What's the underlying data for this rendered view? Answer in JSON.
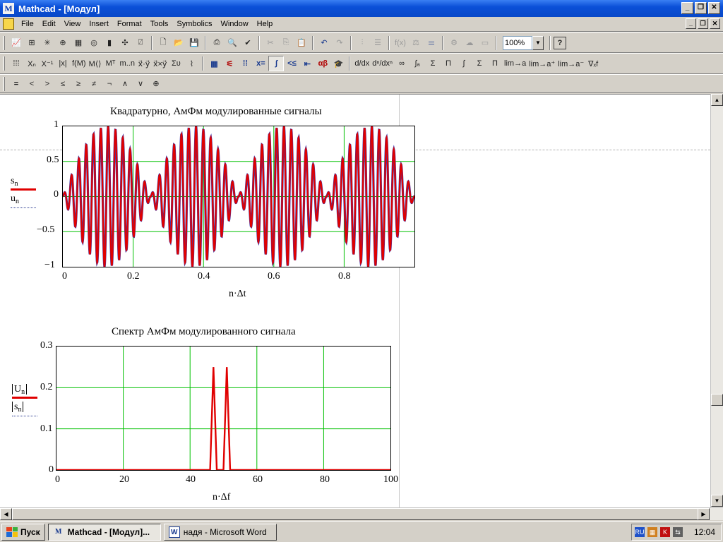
{
  "window": {
    "title": "Mathcad - [Модул]",
    "controls": [
      "minimize",
      "maximize",
      "close"
    ]
  },
  "menu": [
    "File",
    "Edit",
    "View",
    "Insert",
    "Format",
    "Tools",
    "Symbolics",
    "Window",
    "Help"
  ],
  "toolbar": {
    "zoom": "100%",
    "icons_row1": [
      "graph-toolbar-icon",
      "matrix-toolbar-icon",
      "evaluation-toolbar-icon",
      "calculus-toolbar-icon",
      "boolean-toolbar-icon",
      "programming-toolbar-icon",
      "greek-toolbar-icon",
      "symbolic-toolbar-icon",
      "modifier-toolbar-icon",
      "new-document-icon",
      "open-icon",
      "save-icon",
      "print-icon",
      "print-preview-icon",
      "spell-check-icon",
      "cut-icon",
      "copy-icon",
      "paste-icon",
      "undo-icon",
      "redo-icon",
      "align-across-icon",
      "align-down-icon",
      "insert-function-icon",
      "insert-unit-icon",
      "equals-icon",
      "calculate-icon",
      "component-icon",
      "insert-math-icon",
      "help-icon"
    ],
    "matrix_buttons": [
      "⁞⁞⁞",
      "Xₙ",
      "X⁻¹",
      "|x|",
      "f(M)",
      "M⟨⟩",
      "Mᵀ",
      "m..n",
      "x⃗·y⃗",
      "x⃗×y⃗",
      "Συ",
      "⌇"
    ],
    "palette_buttons": [
      "calculator",
      "graph",
      "matrix",
      "x=",
      "∫ d/dx",
      "<≤",
      "programming",
      "αβ",
      "symbolic"
    ],
    "calculus_buttons": [
      "d/dx",
      "dⁿ/dxⁿ",
      "∞",
      "∫ₐ",
      "Σ",
      "Π",
      "∫",
      "Σ",
      "Π",
      "lim→a",
      "lim→a⁺",
      "lim→a⁻",
      "∇ₓf"
    ],
    "boolean_buttons": [
      "=",
      "<",
      ">",
      "≤",
      "≥",
      "≠",
      "¬",
      "∧",
      "∨",
      "⊕"
    ]
  },
  "plot1": {
    "title": "Квадратурно, АмФм модулированные сигналы",
    "xlabel_main": "n·Δt",
    "legend": [
      {
        "sym": "s",
        "sub": "n"
      },
      {
        "sym": "u",
        "sub": "n"
      }
    ],
    "yticks": [
      "1",
      "0.5",
      "0",
      "−0.5",
      "−1"
    ],
    "xticks": [
      "0",
      "0.2",
      "0.4",
      "0.6",
      "0.8"
    ],
    "colors": {
      "s": "#e00000",
      "u": "#3a3ab0",
      "grid": "#00c000"
    }
  },
  "plot2": {
    "title": "Спектр АмФм модулированного сигнала",
    "xlabel_main": "n·Δf",
    "legend": [
      {
        "sym": "U",
        "sub": "n"
      },
      {
        "sym": "s",
        "sub": "n"
      }
    ],
    "yticks": [
      "0.3",
      "0.2",
      "0.1",
      "0"
    ],
    "xticks": [
      "0",
      "20",
      "40",
      "60",
      "80",
      "100"
    ]
  },
  "chart_data": [
    {
      "type": "line",
      "title": "Квадратурно, АмФм модулированные сигналы",
      "xlabel": "n·Δt",
      "ylabel": "s_n, u_n",
      "xlim": [
        0,
        1
      ],
      "ylim": [
        -1,
        1
      ],
      "grid": true,
      "legend_position": "left",
      "description_series": [
        {
          "name": "s_n",
          "style": "solid red",
          "envelope_period": 0.25,
          "carrier_cycles_per_unit": 48,
          "peak": 1
        },
        {
          "name": "u_n",
          "style": "dotted blue",
          "envelope_period": 0.25,
          "carrier_cycles_per_unit": 48,
          "peak": 1
        }
      ]
    },
    {
      "type": "line",
      "title": "Спектр АмФм модулированного сигнала",
      "xlabel": "n·Δf",
      "ylabel": "|U_n|, |s_n|",
      "xlim": [
        0,
        100
      ],
      "ylim": [
        0,
        0.3
      ],
      "grid": true,
      "legend_position": "left",
      "series": [
        {
          "name": "|U_n|",
          "points": [
            [
              0,
              0
            ],
            [
              46,
              0
            ],
            [
              47,
              0.25
            ],
            [
              48,
              0
            ],
            [
              50,
              0
            ],
            [
              51,
              0.25
            ],
            [
              52,
              0
            ],
            [
              100,
              0
            ]
          ]
        },
        {
          "name": "|s_n|",
          "points": [
            [
              0,
              0
            ],
            [
              46,
              0
            ],
            [
              47,
              0.25
            ],
            [
              48,
              0
            ],
            [
              50,
              0
            ],
            [
              51,
              0.25
            ],
            [
              52,
              0
            ],
            [
              100,
              0
            ]
          ]
        }
      ]
    }
  ],
  "taskbar": {
    "start": "Пуск",
    "tasks": [
      {
        "label": "Mathcad - [Модул]...",
        "active": true
      },
      {
        "label": "надя - Microsoft Word",
        "active": false
      }
    ],
    "lang": "RU",
    "clock": "12:04"
  }
}
